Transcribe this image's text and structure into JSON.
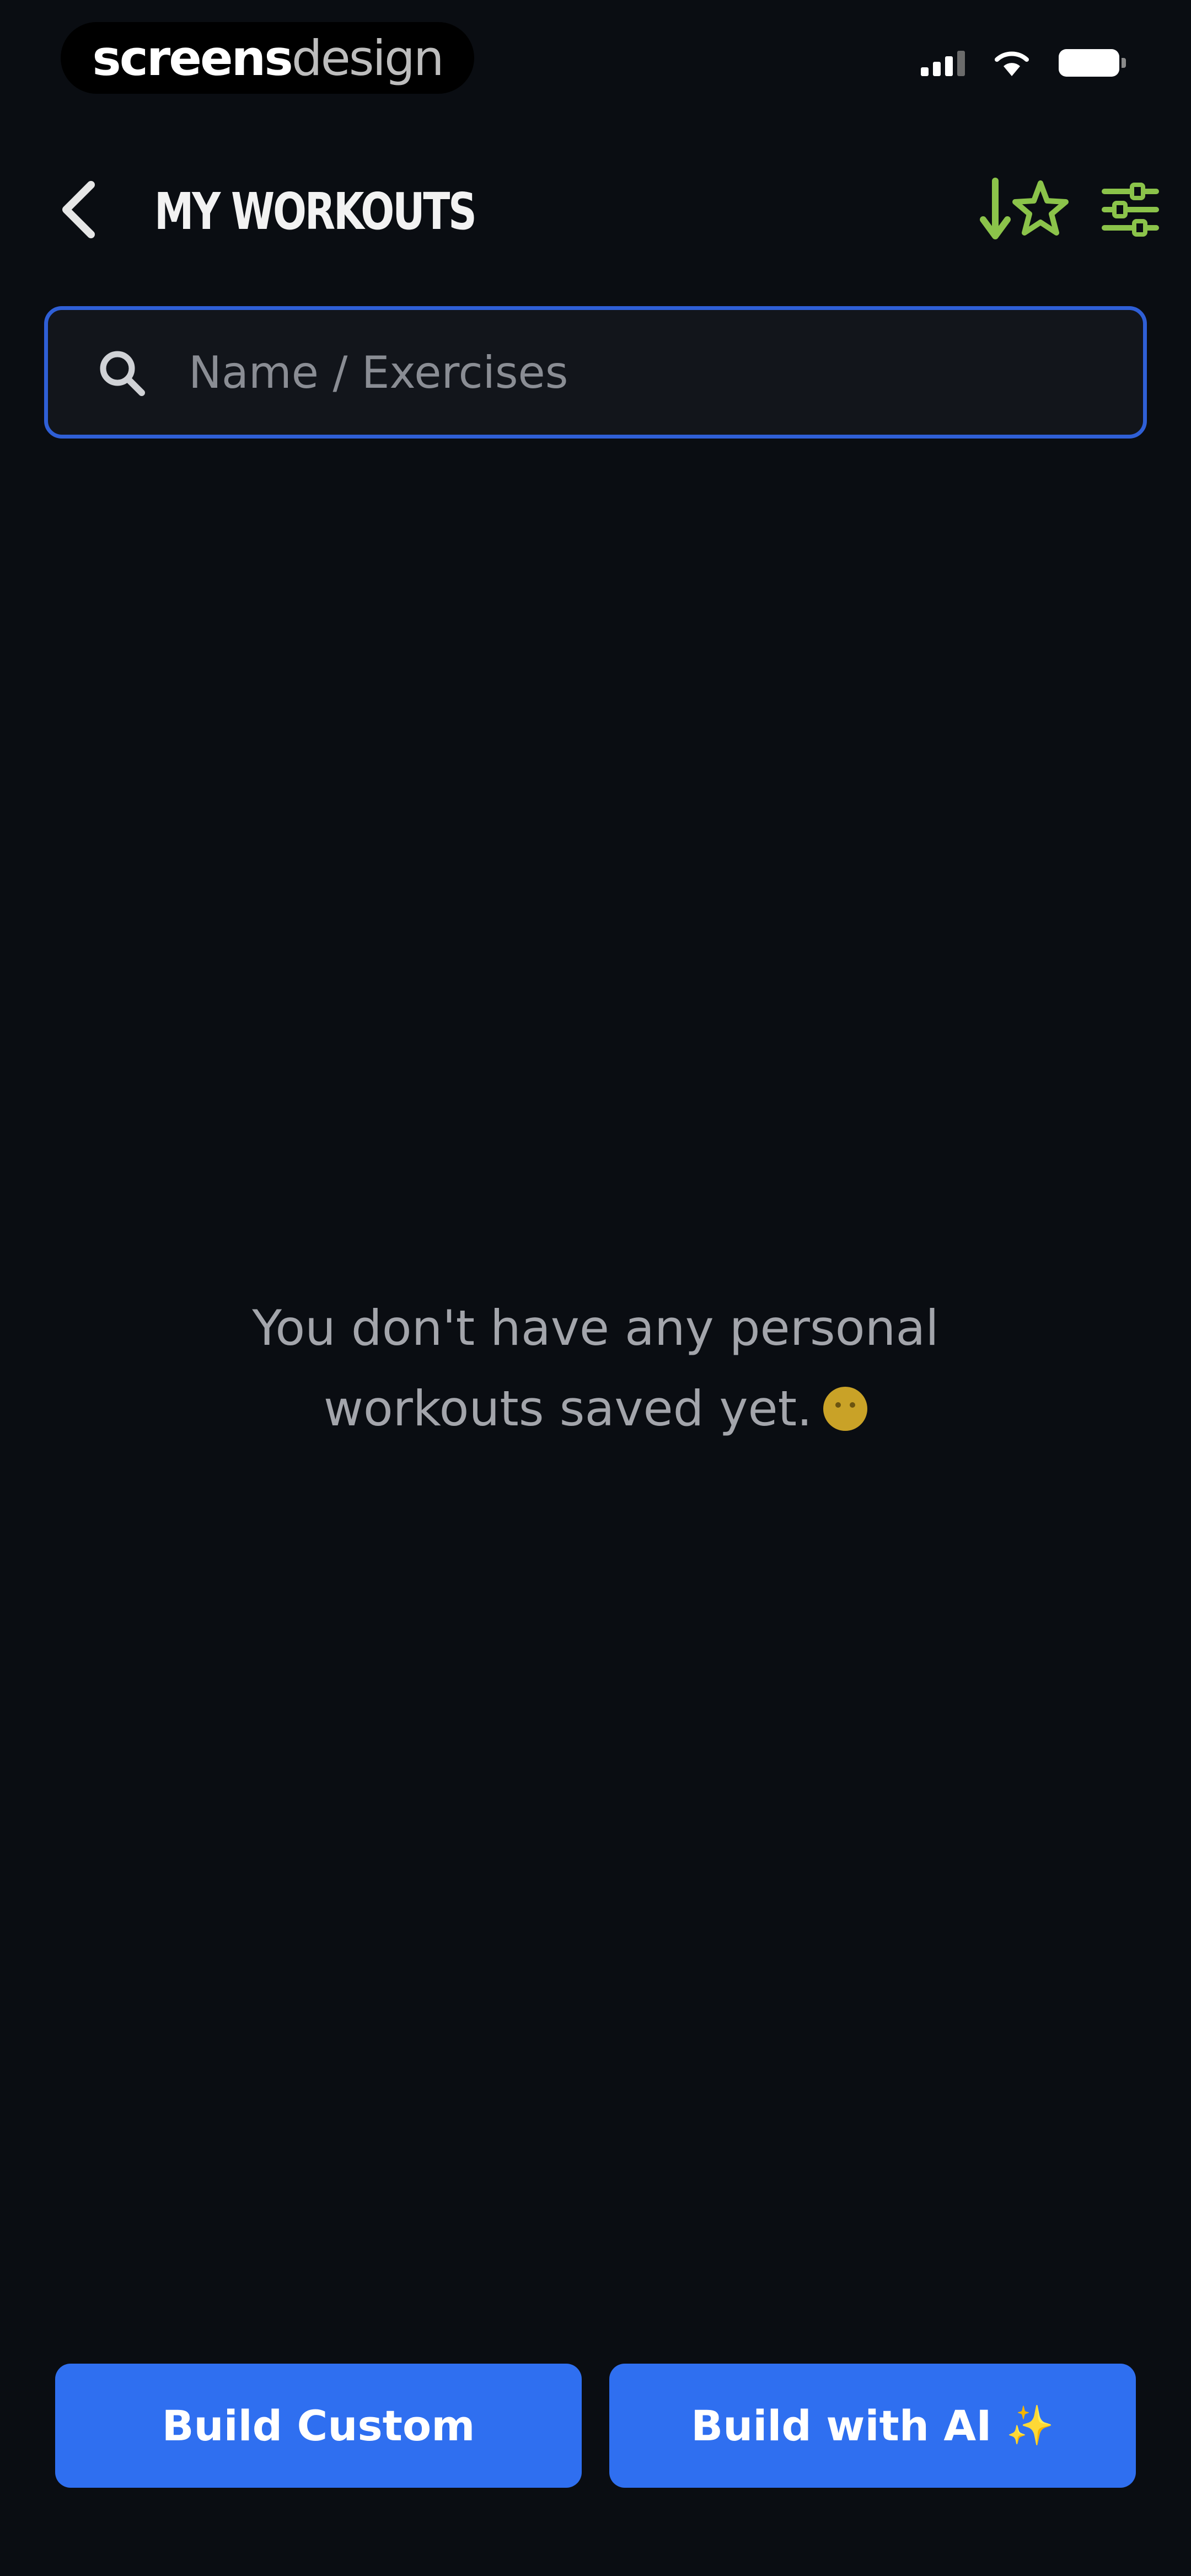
{
  "status_bar": {
    "brand_bold": "screens",
    "brand_light": "design"
  },
  "header": {
    "title": "MY WORKOUTS",
    "back_icon": "chevron-left-icon",
    "sort_icon": "sort-favorites-icon",
    "filter_icon": "sliders-icon",
    "accent_color": "#8bc34a"
  },
  "search": {
    "placeholder": "Name / Exercises",
    "value": "",
    "border_color": "#2f5fd6"
  },
  "empty_state": {
    "message_line1": "You don't have any personal",
    "message_line2": "workouts saved yet.",
    "emoji_icon": "neutral-face-icon"
  },
  "actions": {
    "build_custom_label": "Build Custom",
    "build_ai_label": "Build with AI",
    "build_ai_icon": "sparkles-icon",
    "button_color": "#2f6ff0"
  }
}
